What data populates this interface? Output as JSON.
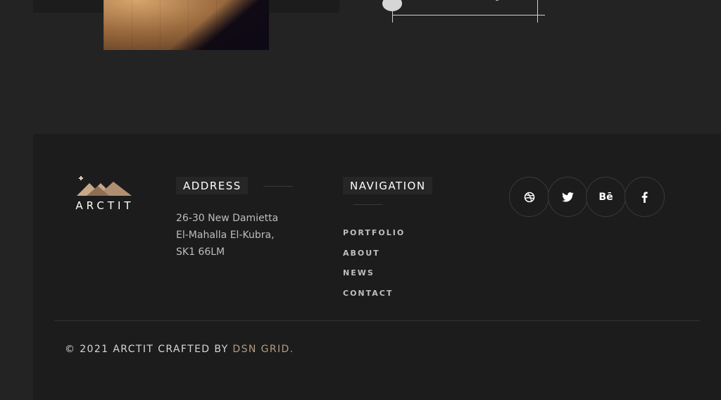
{
  "footer": {
    "logo_text": "ARCTIT",
    "address": {
      "title": "ADDRESS",
      "line1": "26-30 New Damietta",
      "line2": "El-Mahalla El-Kubra,",
      "line3": "SK1 66LM"
    },
    "navigation": {
      "title": "NAVIGATION",
      "items": [
        "PORTFOLIO",
        "ABOUT",
        "NEWS",
        "CONTACT"
      ]
    },
    "social": {
      "icons": [
        "dribbble-icon",
        "twitter-icon",
        "behance-icon",
        "facebook-icon"
      ],
      "behance_label": "Bē"
    },
    "copyright": {
      "prefix": "© 2021 ARCTIT CRAFTED BY ",
      "credit": "DSN GRID."
    }
  },
  "colors": {
    "page_bg": "#232323",
    "footer_bg": "#1c1c1c",
    "accent": "#b39b82"
  }
}
